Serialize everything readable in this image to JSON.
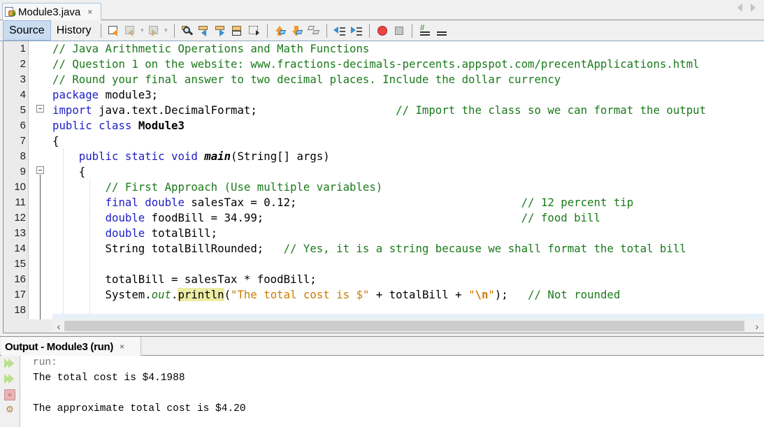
{
  "file_tab": {
    "label": "Module3.java",
    "close": "×"
  },
  "nav": {
    "prev": "previous-document",
    "next": "next-document"
  },
  "toolbar": {
    "source_label": "Source",
    "history_label": "History",
    "icons": [
      "last-edit-icon",
      "back-icon",
      "forward-icon",
      "find-selection-icon",
      "find-previous-icon",
      "find-next-icon",
      "toggle-highlight-icon",
      "toggle-rectangular-selection-icon",
      "previous-bookmark-icon",
      "next-bookmark-icon",
      "toggle-bookmark-icon",
      "shift-left-icon",
      "shift-right-icon",
      "start-macro-icon",
      "stop-macro-icon",
      "comment-icon",
      "uncomment-icon"
    ]
  },
  "editor": {
    "lines": [
      {
        "n": "1",
        "segs": [
          {
            "t": "// Java Arithmetic Operations and Math Functions",
            "c": "cm"
          }
        ]
      },
      {
        "n": "2",
        "segs": [
          {
            "t": "// Question 1 on the website: www.fractions-decimals-percents.appspot.com/precentApplications.html",
            "c": "cm"
          }
        ]
      },
      {
        "n": "3",
        "segs": [
          {
            "t": "// Round your final answer to two decimal places. Include the dollar currency",
            "c": "cm"
          }
        ]
      },
      {
        "n": "4",
        "segs": [
          {
            "t": "package",
            "c": "kw"
          },
          {
            "t": " module3;",
            "c": ""
          }
        ]
      },
      {
        "n": "5",
        "segs": [
          {
            "t": "import",
            "c": "kw"
          },
          {
            "t": " java.text.DecimalFormat;                     ",
            "c": ""
          },
          {
            "t": "// Import the class so we can format the output",
            "c": "cm"
          }
        ]
      },
      {
        "n": "6",
        "segs": [
          {
            "t": "public",
            "c": "kw"
          },
          {
            "t": " ",
            "c": ""
          },
          {
            "t": "class",
            "c": "kw"
          },
          {
            "t": " ",
            "c": ""
          },
          {
            "t": "Module3",
            "c": "bold"
          }
        ]
      },
      {
        "n": "7",
        "segs": [
          {
            "t": "{",
            "c": ""
          }
        ]
      },
      {
        "n": "8",
        "segs": [
          {
            "t": "    ",
            "c": ""
          },
          {
            "t": "public",
            "c": "kw"
          },
          {
            "t": " ",
            "c": ""
          },
          {
            "t": "static",
            "c": "kw"
          },
          {
            "t": " ",
            "c": ""
          },
          {
            "t": "void",
            "c": "kw"
          },
          {
            "t": " ",
            "c": ""
          },
          {
            "t": "main",
            "c": "bold it"
          },
          {
            "t": "(String[] args)",
            "c": ""
          }
        ]
      },
      {
        "n": "9",
        "segs": [
          {
            "t": "    {",
            "c": ""
          }
        ]
      },
      {
        "n": "10",
        "segs": [
          {
            "t": "        ",
            "c": ""
          },
          {
            "t": "// First Approach (Use multiple variables)",
            "c": "cm"
          }
        ]
      },
      {
        "n": "11",
        "segs": [
          {
            "t": "        ",
            "c": ""
          },
          {
            "t": "final",
            "c": "kw"
          },
          {
            "t": " ",
            "c": ""
          },
          {
            "t": "double",
            "c": "kw"
          },
          {
            "t": " salesTax = 0.12;                                  ",
            "c": ""
          },
          {
            "t": "// 12 percent tip",
            "c": "cm"
          }
        ]
      },
      {
        "n": "12",
        "segs": [
          {
            "t": "        ",
            "c": ""
          },
          {
            "t": "double",
            "c": "kw"
          },
          {
            "t": " foodBill = 34.99;                                       ",
            "c": ""
          },
          {
            "t": "// food bill",
            "c": "cm"
          }
        ]
      },
      {
        "n": "13",
        "segs": [
          {
            "t": "        ",
            "c": ""
          },
          {
            "t": "double",
            "c": "kw"
          },
          {
            "t": " totalBill;",
            "c": ""
          }
        ]
      },
      {
        "n": "14",
        "segs": [
          {
            "t": "        String totalBillRounded;   ",
            "c": ""
          },
          {
            "t": "// Yes, it is a string because we shall format the total bill",
            "c": "cm"
          }
        ]
      },
      {
        "n": "15",
        "segs": [
          {
            "t": "",
            "c": ""
          }
        ]
      },
      {
        "n": "16",
        "segs": [
          {
            "t": "        totalBill = salesTax * foodBill;",
            "c": ""
          }
        ]
      },
      {
        "n": "17",
        "segs": [
          {
            "t": "        System.",
            "c": ""
          },
          {
            "t": "out",
            "c": "static-field"
          },
          {
            "t": ".",
            "c": ""
          },
          {
            "t": "println",
            "c": "hl"
          },
          {
            "t": "(",
            "c": ""
          },
          {
            "t": "\"The total cost is $\"",
            "c": "str"
          },
          {
            "t": " + totalBill + ",
            "c": ""
          },
          {
            "t": "\"",
            "c": "str"
          },
          {
            "t": "\\n",
            "c": "str bold"
          },
          {
            "t": "\"",
            "c": "str"
          },
          {
            "t": ");   ",
            "c": ""
          },
          {
            "t": "// Not rounded",
            "c": "cm"
          }
        ]
      },
      {
        "n": "18",
        "segs": [
          {
            "t": "",
            "c": ""
          }
        ]
      }
    ]
  },
  "output": {
    "tab_label": "Output - Module3 (run)",
    "close": "×",
    "side_icons": [
      "rerun-icon",
      "rerun-with-options-icon",
      "stop-icon",
      "settings-icon"
    ],
    "lines": [
      "run:",
      "The total cost is $4.1988",
      "",
      "The approximate total cost is $4.20"
    ]
  }
}
